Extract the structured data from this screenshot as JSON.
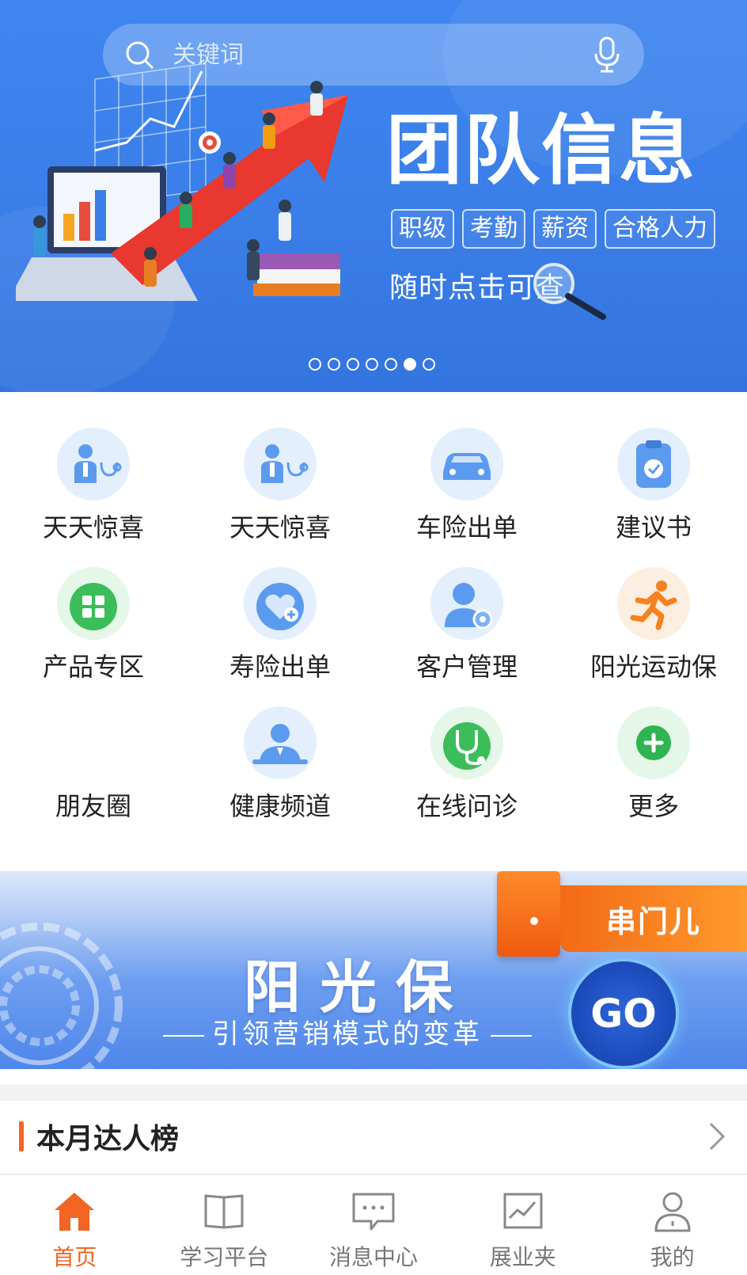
{
  "search": {
    "placeholder": "关键词"
  },
  "hero": {
    "title": "团队信息",
    "tags": [
      "职级",
      "考勤",
      "薪资",
      "合格人力"
    ],
    "subtitle": "随时点击可查",
    "slide_count": 7,
    "active_slide_index": 5
  },
  "menu": {
    "rows": [
      [
        {
          "label": "天天惊喜",
          "icon": "doctor-icon"
        },
        {
          "label": "天天惊喜",
          "icon": "doctor-icon"
        },
        {
          "label": "车险出单",
          "icon": "car-icon"
        },
        {
          "label": "建议书",
          "icon": "clipboard-check-icon"
        }
      ],
      [
        {
          "label": "产品专区",
          "icon": "grid-apps-icon"
        },
        {
          "label": "寿险出单",
          "icon": "heart-plus-icon"
        },
        {
          "label": "客户管理",
          "icon": "user-gear-icon"
        },
        {
          "label": "阳光运动保",
          "icon": "runner-icon"
        }
      ],
      [
        {
          "label": "朋友圈",
          "icon": ""
        },
        {
          "label": "健康频道",
          "icon": "person-icon"
        },
        {
          "label": "在线问诊",
          "icon": "stethoscope-icon"
        },
        {
          "label": "更多",
          "icon": "plus-circle-icon"
        }
      ]
    ]
  },
  "promo": {
    "title": "阳光保",
    "subtitle": "引领营销模式的变革",
    "tag": "串门儿",
    "go": "GO"
  },
  "rank": {
    "title": "本月达人榜"
  },
  "tabbar": [
    {
      "label": "首页",
      "icon": "home-icon",
      "active": true
    },
    {
      "label": "学习平台",
      "icon": "book-icon",
      "active": false
    },
    {
      "label": "消息中心",
      "icon": "chat-icon",
      "active": false
    },
    {
      "label": "展业夹",
      "icon": "chart-folder-icon",
      "active": false
    },
    {
      "label": "我的",
      "icon": "user-icon",
      "active": false
    }
  ],
  "colors": {
    "accent": "#f26522",
    "hero_blue": "#3a7ee8",
    "icon_blue": "#5b9bef",
    "icon_green": "#3bbd5a",
    "icon_orange": "#f5821f"
  }
}
